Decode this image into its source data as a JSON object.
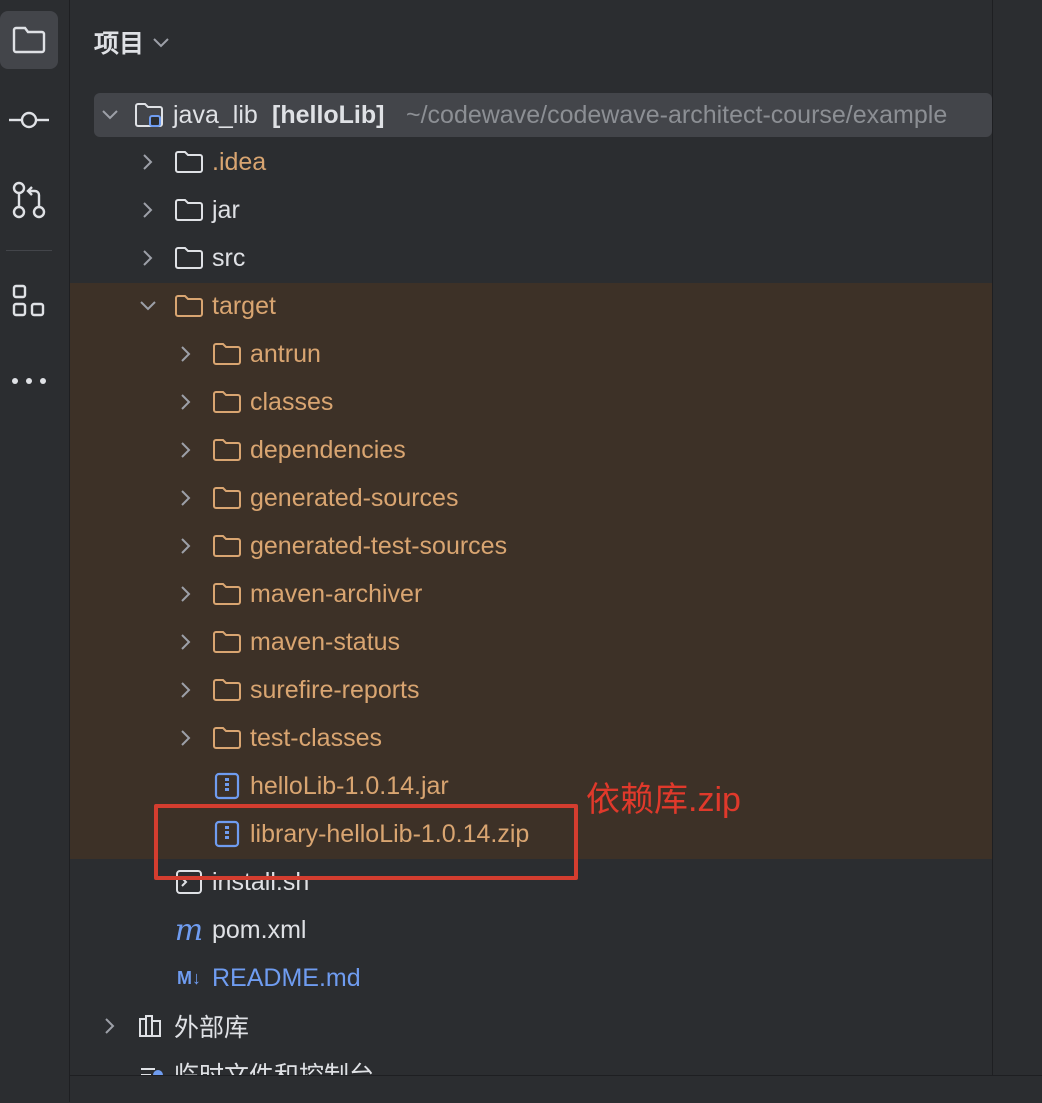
{
  "panel": {
    "title": "项目"
  },
  "root": {
    "name": "java_lib",
    "module": "[helloLib]",
    "path": "~/codewave/codewave-architect-course/example"
  },
  "tree": [
    {
      "label": ".idea",
      "kind": "folder"
    },
    {
      "label": "jar",
      "kind": "folder"
    },
    {
      "label": "src",
      "kind": "folder"
    },
    {
      "label": "target",
      "kind": "folder-open"
    }
  ],
  "target_children": [
    {
      "label": "antrun"
    },
    {
      "label": "classes"
    },
    {
      "label": "dependencies"
    },
    {
      "label": "generated-sources"
    },
    {
      "label": "generated-test-sources"
    },
    {
      "label": "maven-archiver"
    },
    {
      "label": "maven-status"
    },
    {
      "label": "surefire-reports"
    },
    {
      "label": "test-classes"
    }
  ],
  "target_files": [
    {
      "label": "helloLib-1.0.14.jar",
      "icon": "archive-icon"
    },
    {
      "label": "library-helloLib-1.0.14.zip",
      "icon": "archive-icon"
    }
  ],
  "root_files": [
    {
      "label": "install.sh",
      "icon": "shell-icon"
    },
    {
      "label": "pom.xml",
      "icon": "maven-icon"
    },
    {
      "label": "README.md",
      "icon": "markdown-icon"
    }
  ],
  "bottom_items": [
    {
      "label": "外部库",
      "icon": "library-icon"
    },
    {
      "label": "临时文件和控制台",
      "icon": "scratch-icon"
    }
  ],
  "annotation": {
    "text": "依赖库.zip",
    "color": "#e0392b"
  },
  "colors": {
    "highlight": "#3d3127",
    "folder_orange": "#d9a571",
    "blue": "#6f9cf0"
  }
}
